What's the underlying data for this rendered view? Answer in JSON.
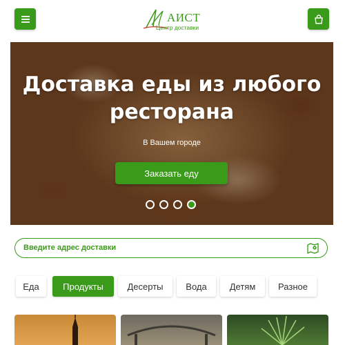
{
  "header": {
    "logo_title": "АИСТ",
    "logo_subtitle": "Центр доставки",
    "menu_icon": "hamburger-icon",
    "cart_icon": "shopping-bag-icon",
    "brand_color": "#3a9a19"
  },
  "hero": {
    "title_line1": "Доставка еды из любого",
    "title_line2": "ресторана",
    "subtitle": "В Вашем городе",
    "order_button": "Заказать еду",
    "slides_count": 4,
    "active_slide": 4
  },
  "address": {
    "placeholder": "Введите адрес доставки",
    "icon": "map-pin-icon"
  },
  "categories": [
    {
      "label": "Еда",
      "active": false
    },
    {
      "label": "Продукты",
      "active": true
    },
    {
      "label": "Десерты",
      "active": false
    },
    {
      "label": "Вода",
      "active": false
    },
    {
      "label": "Детям",
      "active": false
    },
    {
      "label": "Разное",
      "active": false
    }
  ]
}
